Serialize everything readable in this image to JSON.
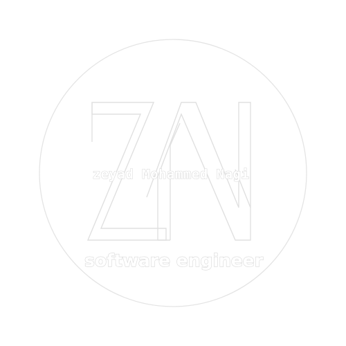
{
  "logo": {
    "monogram_letters": "ZN",
    "name": "zeyad Mohammed Nagi",
    "role": "software engineer"
  },
  "colors": {
    "background": "#ffffff",
    "outline": "#e4e4e4",
    "text_fill": "#ffffff",
    "text_stroke": "#d8d8d8"
  }
}
